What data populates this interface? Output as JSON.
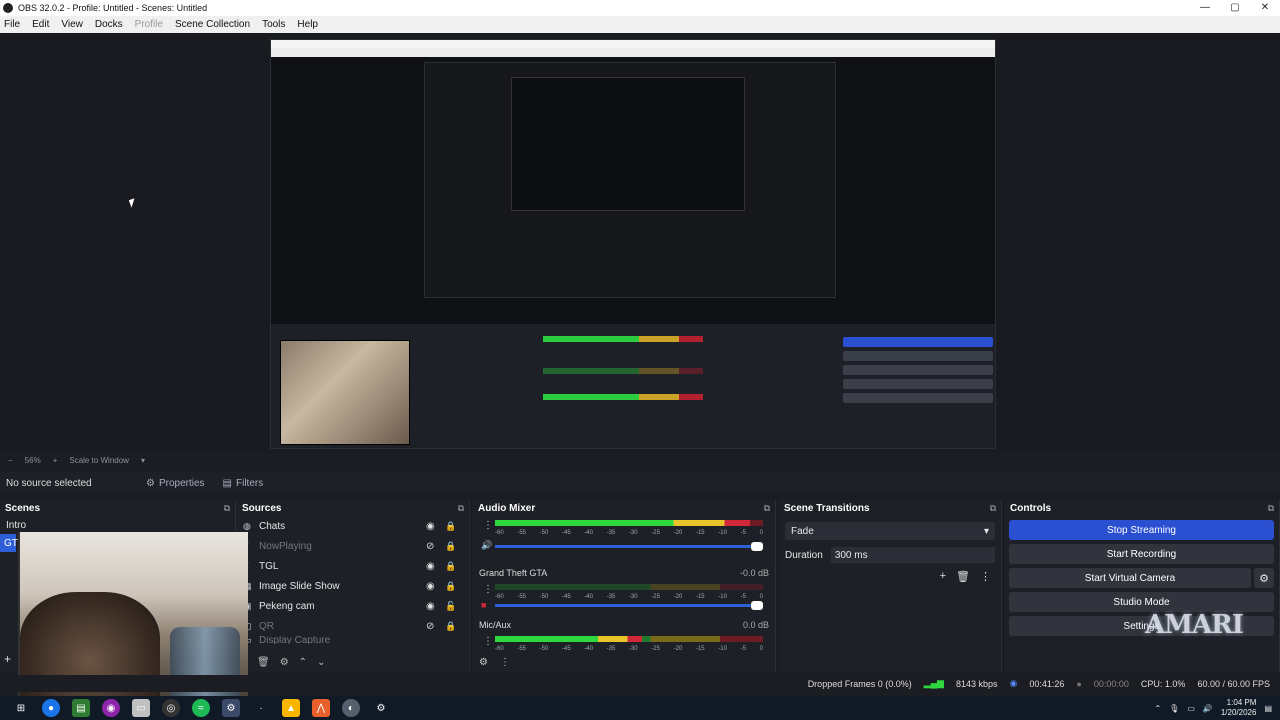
{
  "window": {
    "title": "OBS 32.0.2 - Profile: Untitled - Scenes: Untitled",
    "controls": [
      "—",
      "▢",
      "✕"
    ]
  },
  "menu": [
    "File",
    "Edit",
    "View",
    "Docks",
    "Profile",
    "Scene Collection",
    "Tools",
    "Help"
  ],
  "preview_toolbar": {
    "zoom": "56%",
    "scale_mode": "Scale to Window"
  },
  "source_toolbar": {
    "no_source": "No source selected",
    "properties": "Properties",
    "filters": "Filters"
  },
  "scenes": {
    "title": "Scenes",
    "items": [
      "Intro",
      "GT"
    ],
    "active_index": 1
  },
  "sources": {
    "title": "Sources",
    "items": [
      {
        "name": "Chats",
        "visible": true,
        "locked": true
      },
      {
        "name": "NowPlaying",
        "visible": false,
        "locked": true
      },
      {
        "name": "TGL",
        "visible": true,
        "locked": true
      },
      {
        "name": "Image Slide Show",
        "visible": true,
        "locked": true
      },
      {
        "name": "Pekeng cam",
        "visible": true,
        "locked": false
      },
      {
        "name": "QR",
        "visible": false,
        "locked": true
      },
      {
        "name": "Display Capture",
        "visible": false,
        "locked": false
      }
    ]
  },
  "mixer": {
    "title": "Audio Mixer",
    "ticks": [
      "-60",
      "-55",
      "-50",
      "-45",
      "-40",
      "-35",
      "-30",
      "-25",
      "-20",
      "-15",
      "-10",
      "-5",
      "0"
    ],
    "channels": [
      {
        "name": "",
        "db": "",
        "level": 0.95,
        "muted": false
      },
      {
        "name": "Grand Theft GTA",
        "db": "-0.0 dB",
        "level": 0.0,
        "muted": true
      },
      {
        "name": "Mic/Aux",
        "db": "0.0 dB",
        "level": 0.55,
        "muted": false
      }
    ]
  },
  "transitions": {
    "title": "Scene Transitions",
    "selected": "Fade",
    "duration_label": "Duration",
    "duration_value": "300 ms"
  },
  "controls": {
    "title": "Controls",
    "stop_streaming": "Stop Streaming",
    "start_recording": "Start Recording",
    "start_virtual_camera": "Start Virtual Camera",
    "studio_mode": "Studio Mode",
    "settings": "Settings"
  },
  "watermark": "AMARI",
  "status": {
    "dropped_frames": "Dropped Frames 0 (0.0%)",
    "bitrate": "8143 kbps",
    "stream_time": "00:41:26",
    "record_time": "00:00:00",
    "cpu": "CPU: 1.0%",
    "fps": "60.00 / 60.00 FPS"
  },
  "taskbar": {
    "time": "1:04 PM",
    "date": "1/20/2026"
  },
  "colors": {
    "accent": "#2a4fd1",
    "panel": "#1e2027",
    "meter_green": "#2fd83f",
    "meter_yellow": "#e8c42a",
    "meter_red": "#d2283a"
  }
}
